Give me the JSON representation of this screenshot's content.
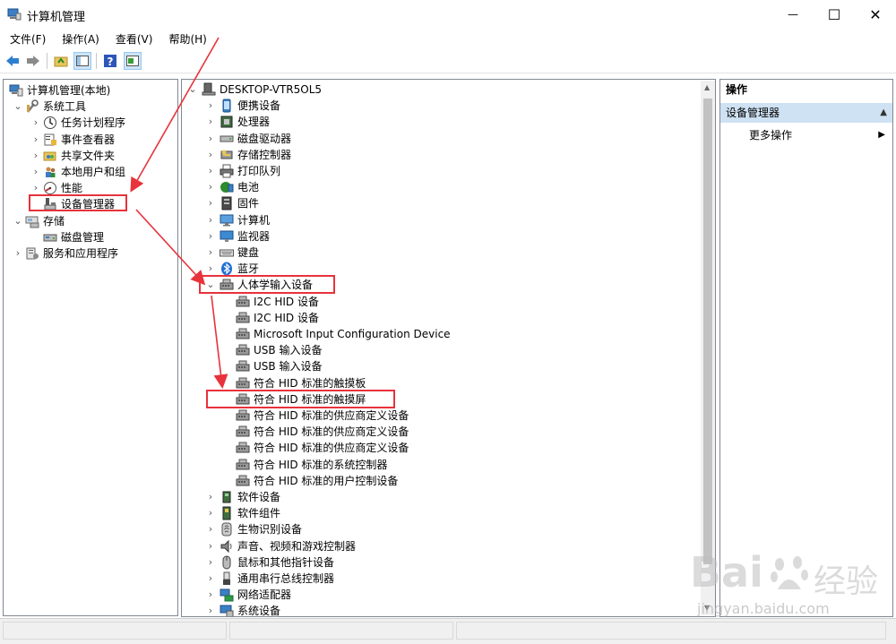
{
  "window": {
    "title": "计算机管理",
    "minimize": "—",
    "maximize": "☐",
    "close": "✕"
  },
  "menu": [
    "文件(F)",
    "操作(A)",
    "查看(V)",
    "帮助(H)"
  ],
  "left_tree": [
    {
      "label": "计算机管理(本地)",
      "chevron": "",
      "icon": "computer-management-icon"
    },
    {
      "label": "系统工具",
      "chevron": "⌄",
      "icon": "system-tools-icon"
    },
    {
      "label": "任务计划程序",
      "chevron": "›",
      "icon": "task-scheduler-icon"
    },
    {
      "label": "事件查看器",
      "chevron": "›",
      "icon": "event-viewer-icon"
    },
    {
      "label": "共享文件夹",
      "chevron": "›",
      "icon": "shared-folder-icon"
    },
    {
      "label": "本地用户和组",
      "chevron": "›",
      "icon": "local-users-icon"
    },
    {
      "label": "性能",
      "chevron": "›",
      "icon": "performance-icon"
    },
    {
      "label": "设备管理器",
      "chevron": "",
      "icon": "device-manager-icon"
    },
    {
      "label": "存储",
      "chevron": "⌄",
      "icon": "storage-icon"
    },
    {
      "label": "磁盘管理",
      "chevron": "",
      "icon": "disk-management-icon"
    },
    {
      "label": "服务和应用程序",
      "chevron": "›",
      "icon": "services-apps-icon"
    }
  ],
  "device_tree": {
    "root": "DESKTOP-VTR5OL5",
    "categories_top": [
      {
        "label": "便携设备",
        "icon": "portable-device-icon"
      },
      {
        "label": "处理器",
        "icon": "processor-icon"
      },
      {
        "label": "磁盘驱动器",
        "icon": "disk-drive-icon"
      },
      {
        "label": "存储控制器",
        "icon": "storage-controller-icon"
      },
      {
        "label": "打印队列",
        "icon": "print-queue-icon"
      },
      {
        "label": "电池",
        "icon": "battery-icon"
      },
      {
        "label": "固件",
        "icon": "firmware-icon"
      },
      {
        "label": "计算机",
        "icon": "computer-icon"
      },
      {
        "label": "监视器",
        "icon": "monitor-icon"
      },
      {
        "label": "键盘",
        "icon": "keyboard-icon"
      },
      {
        "label": "蓝牙",
        "icon": "bluetooth-icon"
      }
    ],
    "hid": {
      "label": "人体学输入设备",
      "children": [
        "I2C HID 设备",
        "I2C HID 设备",
        "Microsoft Input Configuration Device",
        "USB 输入设备",
        "USB 输入设备",
        "符合 HID 标准的触摸板",
        "符合 HID 标准的触摸屏",
        "符合 HID 标准的供应商定义设备",
        "符合 HID 标准的供应商定义设备",
        "符合 HID 标准的供应商定义设备",
        "符合 HID 标准的系统控制器",
        "符合 HID 标准的用户控制设备"
      ]
    },
    "categories_bottom": [
      {
        "label": "软件设备",
        "icon": "software-device-icon"
      },
      {
        "label": "软件组件",
        "icon": "software-component-icon"
      },
      {
        "label": "生物识别设备",
        "icon": "biometric-icon"
      },
      {
        "label": "声音、视频和游戏控制器",
        "icon": "sound-icon"
      },
      {
        "label": "鼠标和其他指针设备",
        "icon": "mouse-icon"
      },
      {
        "label": "通用串行总线控制器",
        "icon": "usb-controller-icon"
      },
      {
        "label": "网络适配器",
        "icon": "network-adapter-icon"
      },
      {
        "label": "系统设备",
        "icon": "system-device-icon"
      }
    ]
  },
  "actions": {
    "header": "操作",
    "section": "设备管理器",
    "more": "更多操作"
  },
  "watermark": {
    "brand": "Bai",
    "brand2": "经验",
    "url": "jingyan.baidu.com"
  },
  "colors": {
    "highlight_box": "#e8323c",
    "section_bg": "#cfe2f3",
    "selected_item_bg": "#cce8ff"
  }
}
